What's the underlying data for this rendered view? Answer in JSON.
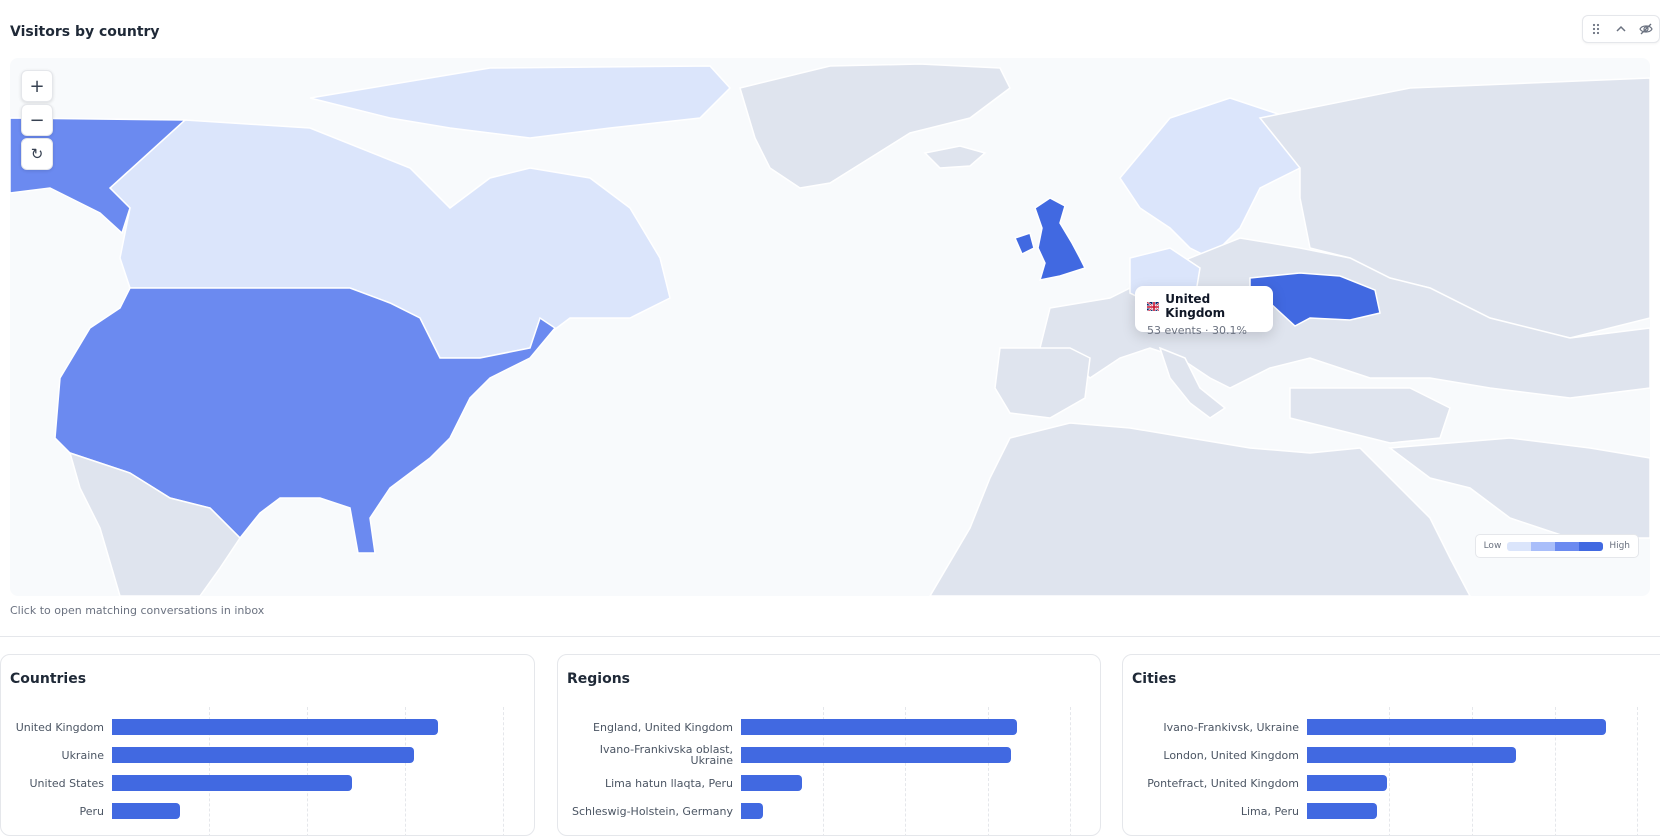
{
  "map_panel": {
    "title": "Visitors by country",
    "caption": "Click to open matching conversations in inbox",
    "zoom_in": "+",
    "zoom_out": "−",
    "reset": "↻",
    "legend": {
      "low": "Low",
      "high": "High",
      "colors": [
        "#dbe5fb",
        "#a9befa",
        "#6b8af0",
        "#4169e1"
      ]
    },
    "tooltip": {
      "country": "United Kingdom",
      "stats": "53 events · 30.1%"
    },
    "colors": {
      "land": "#dfe4ee",
      "low": "#dbe5fb",
      "mid": "#6b8af0",
      "high": "#4169e1"
    },
    "icons": [
      "drag-handle-icon",
      "chevron-up-icon",
      "eye-off-icon",
      "plus-icon",
      "minus-icon",
      "reset-icon",
      "uk-flag-icon"
    ]
  },
  "cards": [
    {
      "title": "Countries",
      "scale_max": 64,
      "rows": [
        {
          "label": "United Kingdom",
          "value": 53
        },
        {
          "label": "Ukraine",
          "value": 49
        },
        {
          "label": "United States",
          "value": 39
        },
        {
          "label": "Peru",
          "value": 11
        }
      ]
    },
    {
      "title": "Regions",
      "scale_max": 52,
      "rows": [
        {
          "label": "England, United Kingdom",
          "value": 43
        },
        {
          "label": "Ivano-Frankivska oblast, Ukraine",
          "value": 42
        },
        {
          "label": "Lima hatun llaqta, Peru",
          "value": 9.5
        },
        {
          "label": "Schleswig-Holstein, Germany",
          "value": 3.5
        }
      ]
    },
    {
      "title": "Cities",
      "scale_max": 48,
      "rows": [
        {
          "label": "Ivano-Frankivsk, Ukraine",
          "value": 43
        },
        {
          "label": "London, United Kingdom",
          "value": 30
        },
        {
          "label": "Pontefract, United Kingdom",
          "value": 11.5
        },
        {
          "label": "Lima, Peru",
          "value": 10
        }
      ]
    }
  ],
  "chart_data": [
    {
      "type": "bar",
      "title": "Countries",
      "categories": [
        "United Kingdom",
        "Ukraine",
        "United States",
        "Peru"
      ],
      "values": [
        53,
        49,
        39,
        11
      ]
    },
    {
      "type": "bar",
      "title": "Regions",
      "categories": [
        "England, United Kingdom",
        "Ivano-Frankivska oblast, Ukraine",
        "Lima hatun llaqta, Peru",
        "Schleswig-Holstein, Germany"
      ],
      "values": [
        43,
        42,
        9.5,
        3.5
      ]
    },
    {
      "type": "bar",
      "title": "Cities",
      "categories": [
        "Ivano-Frankivsk, Ukraine",
        "London, United Kingdom",
        "Pontefract, United Kingdom",
        "Lima, Peru"
      ],
      "values": [
        43,
        30,
        11.5,
        10
      ]
    }
  ]
}
